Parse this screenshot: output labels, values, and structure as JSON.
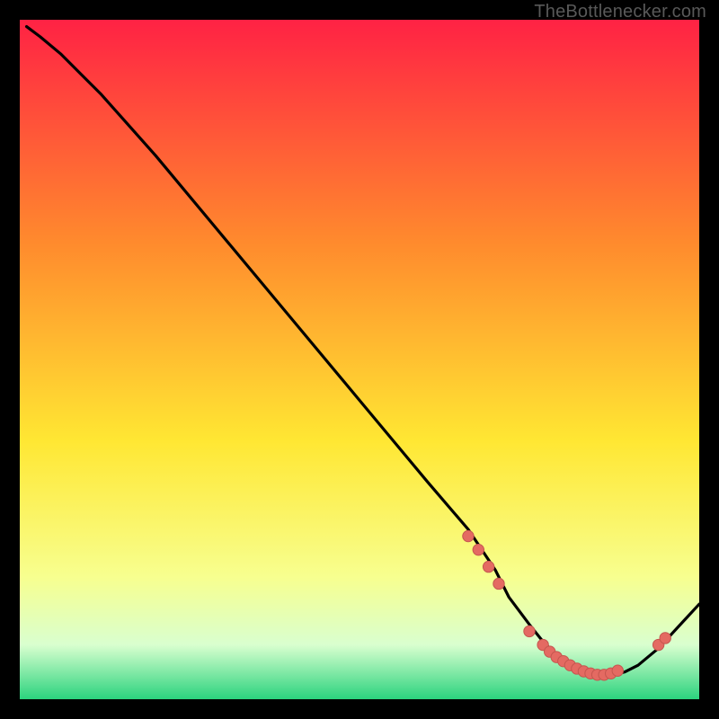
{
  "attribution": "TheBottlenecker.com",
  "colors": {
    "bg": "#000000",
    "grad_top": "#ff2244",
    "grad_mid1": "#ff8b2d",
    "grad_mid2": "#ffe733",
    "grad_low1": "#f7ff8f",
    "grad_low2": "#d9ffcf",
    "grad_bottom": "#2bd37e",
    "curve": "#000000",
    "marker_fill": "#e46a62",
    "marker_stroke": "#c5564f"
  },
  "chart_data": {
    "type": "line",
    "title": "",
    "xlabel": "",
    "ylabel": "",
    "xlim": [
      0,
      100
    ],
    "ylim": [
      0,
      100
    ],
    "series": [
      {
        "name": "bottleneck-curve",
        "x": [
          1,
          3,
          6,
          9,
          12,
          20,
          30,
          40,
          50,
          60,
          66,
          70,
          72,
          75,
          77,
          79,
          81,
          83,
          85,
          87,
          89,
          91,
          94,
          100
        ],
        "y": [
          99,
          97.5,
          95,
          92,
          89,
          80,
          68,
          56,
          44,
          32,
          25,
          19,
          15,
          11,
          8.5,
          6.5,
          5,
          4,
          3.5,
          3.5,
          4,
          5,
          7.5,
          14
        ]
      }
    ],
    "markers": [
      {
        "x": 66,
        "y": 24
      },
      {
        "x": 67.5,
        "y": 22
      },
      {
        "x": 69,
        "y": 19.5
      },
      {
        "x": 70.5,
        "y": 17
      },
      {
        "x": 75,
        "y": 10
      },
      {
        "x": 77,
        "y": 8
      },
      {
        "x": 78,
        "y": 7
      },
      {
        "x": 79,
        "y": 6.2
      },
      {
        "x": 80,
        "y": 5.6
      },
      {
        "x": 81,
        "y": 5
      },
      {
        "x": 82,
        "y": 4.5
      },
      {
        "x": 83,
        "y": 4.1
      },
      {
        "x": 84,
        "y": 3.8
      },
      {
        "x": 85,
        "y": 3.6
      },
      {
        "x": 86,
        "y": 3.6
      },
      {
        "x": 87,
        "y": 3.8
      },
      {
        "x": 88,
        "y": 4.2
      },
      {
        "x": 94,
        "y": 8
      },
      {
        "x": 95,
        "y": 9
      }
    ]
  }
}
